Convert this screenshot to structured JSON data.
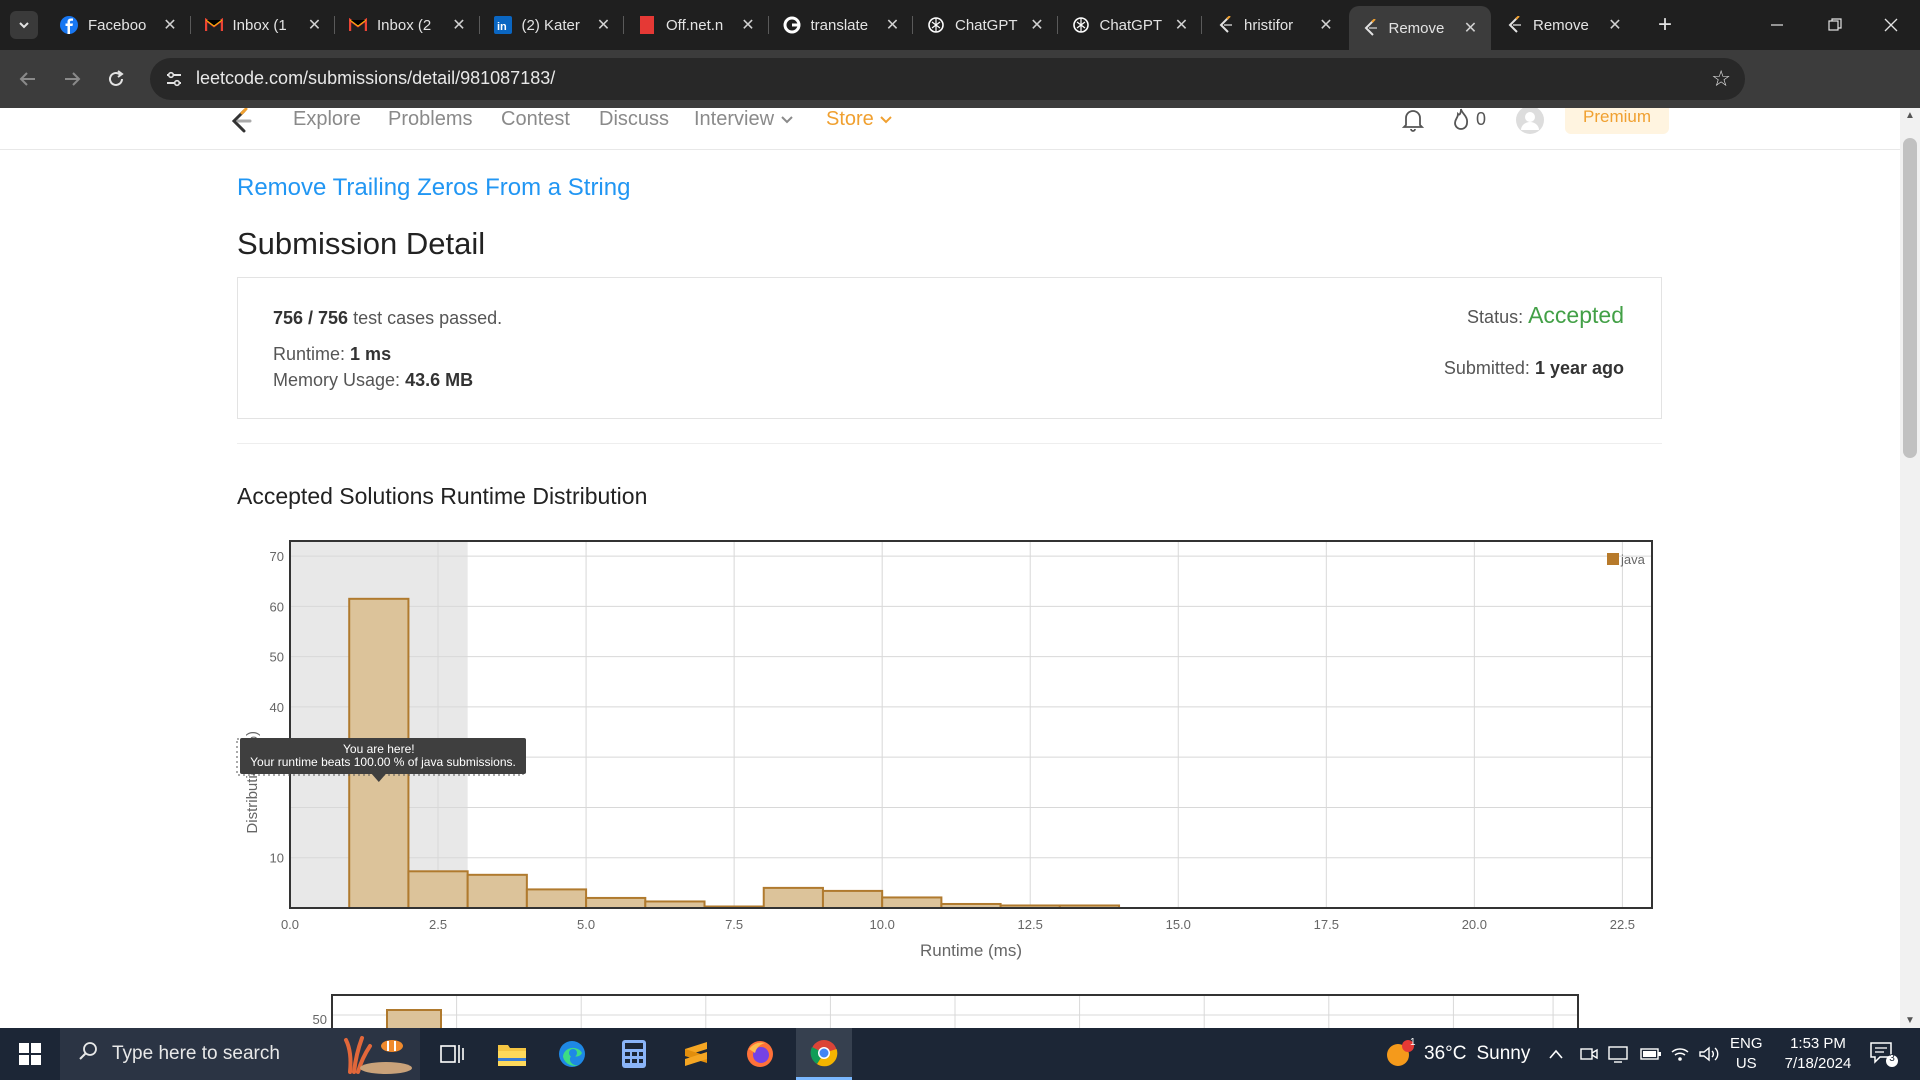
{
  "browser": {
    "tabs": [
      {
        "title": "Faceboo",
        "icon": "facebook-icon",
        "color": "#1877f2",
        "active": false
      },
      {
        "title": "Inbox (1",
        "icon": "gmail-icon",
        "color": "#ea4335",
        "active": false
      },
      {
        "title": "Inbox (2",
        "icon": "gmail-icon",
        "color": "#ea4335",
        "active": false
      },
      {
        "title": "(2) Kater",
        "icon": "linkedin-icon",
        "color": "#0a66c2",
        "active": false
      },
      {
        "title": "Off.net.n",
        "icon": "pdf-icon",
        "color": "#e53935",
        "active": false
      },
      {
        "title": "translate",
        "icon": "google-icon",
        "color": "#4285f4",
        "active": false
      },
      {
        "title": "ChatGPT",
        "icon": "openai-icon",
        "color": "#ffffff",
        "active": false
      },
      {
        "title": "ChatGPT",
        "icon": "openai-icon",
        "color": "#ffffff",
        "active": false
      },
      {
        "title": "hristifor",
        "icon": "leetcode-icon",
        "color": "#f0a030",
        "active": false
      },
      {
        "title": "Remove",
        "icon": "leetcode-icon",
        "color": "#f0a030",
        "active": true
      },
      {
        "title": "Remove",
        "icon": "leetcode-icon",
        "color": "#f0a030",
        "active": false
      }
    ],
    "url": "leetcode.com/submissions/detail/981087183/",
    "profile_initial": "H"
  },
  "leetcode_nav": {
    "links": [
      "Explore",
      "Problems",
      "Contest",
      "Discuss",
      "Interview",
      "Store"
    ],
    "streak_count": "0",
    "premium_label": "Premium"
  },
  "submission": {
    "problem_title": "Remove Trailing Zeros From a String",
    "heading": "Submission Detail",
    "passed_count": "756 / 756",
    "passed_suffix": "test cases passed.",
    "runtime_label": "Runtime:",
    "runtime_value": "1 ms",
    "memory_label": "Memory Usage:",
    "memory_value": "43.6 MB",
    "status_label": "Status:",
    "status_value": "Accepted",
    "submitted_label": "Submitted:",
    "submitted_value": "1 year ago"
  },
  "distribution_title": "Accepted Solutions Runtime Distribution",
  "chart_data": [
    {
      "type": "bar",
      "xlabel": "Runtime (ms)",
      "ylabel": "Distribution (%)",
      "xlim": [
        0,
        23
      ],
      "ylim": [
        0,
        73
      ],
      "x_ticks": [
        "0.0",
        "2.5",
        "5.0",
        "7.5",
        "10.0",
        "12.5",
        "15.0",
        "17.5",
        "20.0",
        "22.5"
      ],
      "y_ticks": [
        "10",
        "30",
        "40",
        "50",
        "60",
        "70"
      ],
      "bins": [
        {
          "start": 1,
          "end": 2,
          "value": 61.5
        },
        {
          "start": 2,
          "end": 3,
          "value": 7.3
        },
        {
          "start": 3,
          "end": 4,
          "value": 6.6
        },
        {
          "start": 4,
          "end": 5,
          "value": 3.7
        },
        {
          "start": 5,
          "end": 6,
          "value": 2.0
        },
        {
          "start": 6,
          "end": 7,
          "value": 1.3
        },
        {
          "start": 7,
          "end": 8,
          "value": 0.3
        },
        {
          "start": 8,
          "end": 9,
          "value": 4.0
        },
        {
          "start": 9,
          "end": 10,
          "value": 3.4
        },
        {
          "start": 10,
          "end": 11,
          "value": 2.1
        },
        {
          "start": 11,
          "end": 12,
          "value": 0.8
        },
        {
          "start": 12,
          "end": 13,
          "value": 0.5
        },
        {
          "start": 13,
          "end": 14,
          "value": 0.5
        }
      ],
      "highlight_range": [
        0,
        3
      ],
      "legend": "java",
      "legend_position": "top-right",
      "tooltip_title": "You are here!",
      "tooltip_text": "Your runtime beats 100.00 % of java submissions.",
      "bar_color": "#dcc39a",
      "bar_stroke": "#b07a2e"
    },
    {
      "type": "bar",
      "y_ticks": [
        "50"
      ],
      "partial": true
    }
  ],
  "taskbar": {
    "search_placeholder": "Type here to search",
    "weather_temp": "36°C",
    "weather_text": "Sunny",
    "weather_badge": "1",
    "lang_top": "ENG",
    "lang_bottom": "US",
    "time": "1:53 PM",
    "date": "7/18/2024",
    "notifications": "3"
  }
}
